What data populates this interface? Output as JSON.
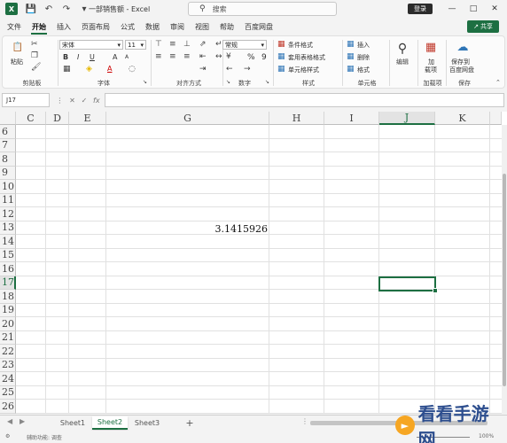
{
  "titlebar": {
    "app_icon": "excel-icon",
    "file_title": "一部销售额 - Excel",
    "search_placeholder": "搜索",
    "login_label": "登录"
  },
  "menu": {
    "tabs": [
      "文件",
      "开始",
      "插入",
      "页面布局",
      "公式",
      "数据",
      "审阅",
      "视图",
      "帮助",
      "百度网盘"
    ],
    "active": "开始",
    "share_label": "共享"
  },
  "ribbon": {
    "clipboard": {
      "paste": "粘贴",
      "label": "剪贴板"
    },
    "font": {
      "name": "宋体",
      "size": "11",
      "bold": "B",
      "italic": "I",
      "underline": "U",
      "font_color": "A",
      "grow": "A",
      "shrink": "A",
      "label": "字体"
    },
    "alignment": {
      "label": "对齐方式"
    },
    "number": {
      "format": "常规",
      "percent": "%",
      "comma": "9",
      "label": "数字"
    },
    "styles": {
      "conditional": "条件格式",
      "table": "套用表格格式",
      "cell_styles": "单元格样式",
      "label": "样式"
    },
    "cells": {
      "insert": "插入",
      "delete": "删除",
      "format": "格式",
      "label": "单元格"
    },
    "editing": {
      "label": "编辑"
    },
    "addins": {
      "line1": "加",
      "line2": "载项",
      "label": "加载项"
    },
    "save": {
      "line1": "保存到",
      "line2": "百度网盘",
      "label": "保存"
    }
  },
  "formula_bar": {
    "name_box": "J17",
    "cancel": "✕",
    "confirm": "✓",
    "fx": "fx",
    "formula": ""
  },
  "grid": {
    "columns": [
      "C",
      "D",
      "E",
      "G",
      "H",
      "I",
      "J",
      "K"
    ],
    "selected_column": "J",
    "rows": [
      "6",
      "7",
      "8",
      "9",
      "10",
      "11",
      "12",
      "13",
      "14",
      "15",
      "16",
      "17",
      "18",
      "19",
      "20",
      "21",
      "22",
      "23",
      "24",
      "25",
      "26"
    ],
    "selected_row": "17",
    "cell_value": "3.1415926",
    "cell_value_address": "G13",
    "active_cell": "J17"
  },
  "sheets": {
    "tabs": [
      "Sheet1",
      "Sheet2",
      "Sheet3"
    ],
    "active": "Sheet2",
    "add": "+"
  },
  "status": {
    "text": "辅助功能: 调查",
    "zoom": "100%"
  },
  "watermark": {
    "text": "看看手游网"
  },
  "colors": {
    "accent": "#1d6f42",
    "header_bg": "#f3f3f3",
    "gridline": "#e1e1e1"
  }
}
